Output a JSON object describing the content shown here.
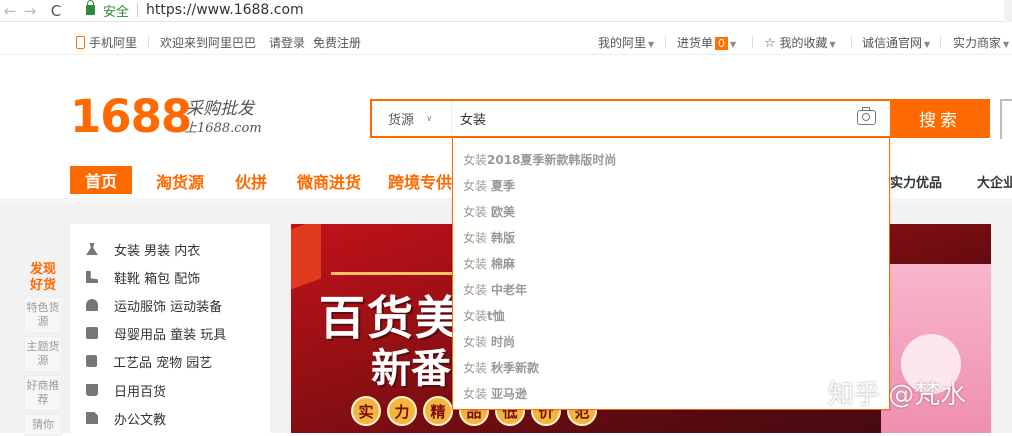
{
  "browser": {
    "back": "←",
    "forward": "→",
    "reload": "C",
    "secure_label": "安全",
    "url": "https://www.1688.com"
  },
  "topbar": {
    "mobile": "手机阿里",
    "welcome": "欢迎来到阿里巴巴",
    "login": "请登录",
    "register": "免费注册",
    "my_ali": "我的阿里",
    "cart": "进货单",
    "cart_count": "0",
    "favorites": "我的收藏",
    "chengxintong": "诚信通官网",
    "merchant": "实力商家"
  },
  "logo": {
    "number": "1688",
    "tagline1": "采购批发",
    "tagline2": "上1688.com"
  },
  "search": {
    "category": "货源",
    "query": "女装",
    "button": "搜索"
  },
  "nav": {
    "home": "首页",
    "items": [
      "淘货源",
      "伙拼",
      "微商进货",
      "跨境专供"
    ],
    "right_items": [
      "实力优品",
      "大企业"
    ]
  },
  "left_mini": {
    "hot": "发现好货",
    "items": [
      "特色货源",
      "主题货源",
      "好商推荐",
      "猜你"
    ]
  },
  "categories": [
    {
      "icon": "dress-icon",
      "label": "女装 男装 内衣"
    },
    {
      "icon": "shoe-icon",
      "label": "鞋靴 箱包 配饰"
    },
    {
      "icon": "sport-icon",
      "label": "运动服饰 运动装备"
    },
    {
      "icon": "baby-icon",
      "label": "母婴用品 童装 玩具"
    },
    {
      "icon": "craft-icon",
      "label": "工艺品 宠物 园艺"
    },
    {
      "icon": "cup-icon",
      "label": "日用百货"
    },
    {
      "icon": "office-icon",
      "label": "办公文教"
    }
  ],
  "banner": {
    "title_line1": "百货美",
    "title_line2": "新番",
    "pills": [
      "实",
      "力",
      "精",
      "品",
      "低",
      "价",
      "范"
    ]
  },
  "suggestions": [
    {
      "prefix": "女装",
      "suffix": "2018夏季新款韩版时尚"
    },
    {
      "prefix": "女装",
      "suffix": "夏季"
    },
    {
      "prefix": "女装",
      "suffix": "欧美"
    },
    {
      "prefix": "女装",
      "suffix": "韩版"
    },
    {
      "prefix": "女装",
      "suffix": "棉麻"
    },
    {
      "prefix": "女装",
      "suffix": "中老年"
    },
    {
      "prefix": "女装",
      "suffix": "t恤"
    },
    {
      "prefix": "女装",
      "suffix": "时尚"
    },
    {
      "prefix": "女装",
      "suffix": "秋季新款"
    },
    {
      "prefix": "女装",
      "suffix": "亚马逊"
    }
  ],
  "watermark": "知乎 @梵水"
}
